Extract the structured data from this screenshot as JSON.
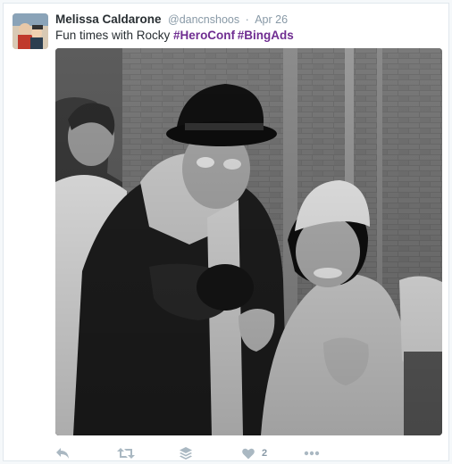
{
  "tweet": {
    "author_name": "Melissa Caldarone",
    "author_handle": "@dancnshoos",
    "separator": "·",
    "timestamp": "Apr 26",
    "text_prefix": "Fun times with Rocky ",
    "hashtags": [
      "#HeroConf",
      "#BingAds"
    ],
    "hashtag_color": "#6f2d91"
  },
  "actions": {
    "reply_icon": "reply-icon",
    "retweet_icon": "retweet-icon",
    "buffer_icon": "buffer-stack-icon",
    "like_icon": "heart-icon",
    "like_count": "2",
    "more_icon": "more-dots-icon",
    "icon_color": "#aab8c2"
  },
  "media": {
    "type": "black-and-white photo"
  }
}
